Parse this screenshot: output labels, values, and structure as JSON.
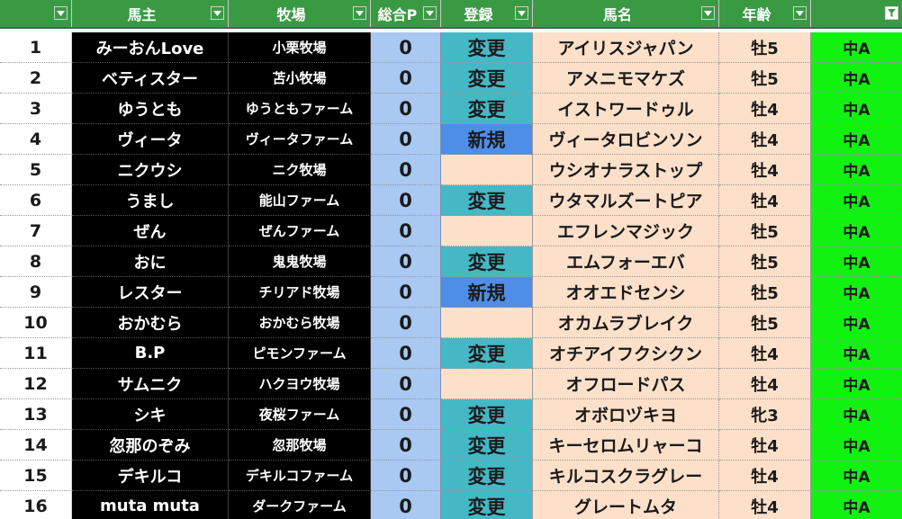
{
  "header": {
    "columns": [
      "",
      "馬主",
      "牧場",
      "総合P",
      "登録",
      "馬名",
      "年齢",
      ""
    ],
    "filter_icon": "filter-dropdown-icon",
    "active_filter_icon": "filter-active-icon"
  },
  "colors": {
    "header_bg": "#3a9a44",
    "owner_bg": "#000000",
    "points_bg": "#a9c8f2",
    "registration_change_bg": "#45b8c6",
    "registration_new_bg": "#4f8ee6",
    "horse_bg": "#fde0c9",
    "class_bg": "#11f211"
  },
  "rows": [
    {
      "no": "1",
      "owner": "みーおんLove",
      "farm": "小栗牧場",
      "points": "0",
      "reg": "変更",
      "reg_type": "change",
      "horse": "アイリスジャパン",
      "age": "牡5",
      "cls": "中A"
    },
    {
      "no": "2",
      "owner": "ベティスター",
      "farm": "苫小牧場",
      "points": "0",
      "reg": "変更",
      "reg_type": "change",
      "horse": "アメニモマケズ",
      "age": "牡5",
      "cls": "中A"
    },
    {
      "no": "3",
      "owner": "ゆうとも",
      "farm": "ゆうともファーム",
      "points": "0",
      "reg": "変更",
      "reg_type": "change",
      "horse": "イストワードゥル",
      "age": "牡4",
      "cls": "中A"
    },
    {
      "no": "4",
      "owner": "ヴィータ",
      "farm": "ヴィータファーム",
      "points": "0",
      "reg": "新規",
      "reg_type": "new",
      "horse": "ヴィータロビンソン",
      "age": "牡4",
      "cls": "中A"
    },
    {
      "no": "5",
      "owner": "ニクウシ",
      "farm": "ニク牧場",
      "points": "0",
      "reg": "",
      "reg_type": "none",
      "horse": "ウシオナラストップ",
      "age": "牡4",
      "cls": "中A"
    },
    {
      "no": "6",
      "owner": "うまし",
      "farm": "能山ファーム",
      "points": "0",
      "reg": "変更",
      "reg_type": "change",
      "horse": "ウタマルズートピア",
      "age": "牡4",
      "cls": "中A"
    },
    {
      "no": "7",
      "owner": "ぜん",
      "farm": "ぜんファーム",
      "points": "0",
      "reg": "",
      "reg_type": "none",
      "horse": "エフレンマジック",
      "age": "牡5",
      "cls": "中A"
    },
    {
      "no": "8",
      "owner": "おに",
      "farm": "鬼鬼牧場",
      "points": "0",
      "reg": "変更",
      "reg_type": "change",
      "horse": "エムフォーエバ",
      "age": "牡5",
      "cls": "中A"
    },
    {
      "no": "9",
      "owner": "レスター",
      "farm": "チリアド牧場",
      "points": "0",
      "reg": "新規",
      "reg_type": "new",
      "horse": "オオエドセンシ",
      "age": "牡5",
      "cls": "中A"
    },
    {
      "no": "10",
      "owner": "おかむら",
      "farm": "おかむら牧場",
      "points": "0",
      "reg": "",
      "reg_type": "none",
      "horse": "オカムラブレイク",
      "age": "牡5",
      "cls": "中A"
    },
    {
      "no": "11",
      "owner": "B.P",
      "farm": "ピモンファーム",
      "points": "0",
      "reg": "変更",
      "reg_type": "change",
      "horse": "オチアイフクシクン",
      "age": "牡4",
      "cls": "中A"
    },
    {
      "no": "12",
      "owner": "サムニク",
      "farm": "ハクヨウ牧場",
      "points": "0",
      "reg": "",
      "reg_type": "none",
      "horse": "オフロードパス",
      "age": "牡4",
      "cls": "中A"
    },
    {
      "no": "13",
      "owner": "シキ",
      "farm": "夜桜ファーム",
      "points": "0",
      "reg": "変更",
      "reg_type": "change",
      "horse": "オボロヅキヨ",
      "age": "牝3",
      "cls": "中A"
    },
    {
      "no": "14",
      "owner": "忽那のぞみ",
      "farm": "忽那牧場",
      "points": "0",
      "reg": "変更",
      "reg_type": "change",
      "horse": "キーセロムリャーコ",
      "age": "牡4",
      "cls": "中A"
    },
    {
      "no": "15",
      "owner": "デキルコ",
      "farm": "デキルコファーム",
      "points": "0",
      "reg": "変更",
      "reg_type": "change",
      "horse": "キルコスクラグレー",
      "age": "牡4",
      "cls": "中A"
    },
    {
      "no": "16",
      "owner": "muta muta",
      "farm": "ダークファーム",
      "points": "0",
      "reg": "変更",
      "reg_type": "change",
      "horse": "グレートムタ",
      "age": "牡4",
      "cls": "中A"
    }
  ]
}
